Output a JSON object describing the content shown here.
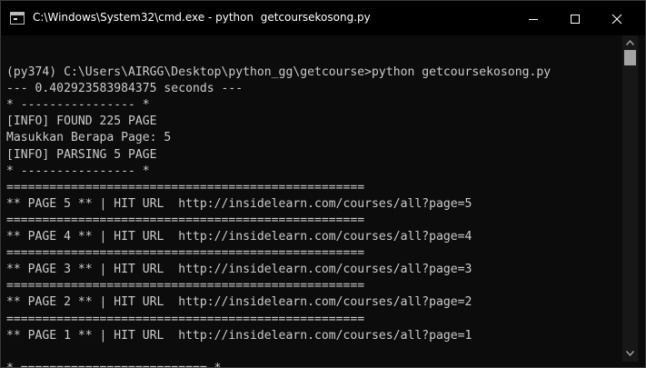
{
  "window": {
    "title": "C:\\Windows\\System32\\cmd.exe - python  getcoursekosong.py"
  },
  "console": {
    "lines": [
      "",
      "(py374) C:\\Users\\AIRGG\\Desktop\\python_gg\\getcourse>python getcoursekosong.py",
      "--- 0.402923583984375 seconds ---",
      "* ---------------- *",
      "[INFO] FOUND 225 PAGE",
      "Masukkan Berapa Page: 5",
      "[INFO] PARSING 5 PAGE",
      "* ---------------- *",
      "==================================================",
      "** PAGE 5 ** | HIT URL  http://insidelearn.com/courses/all?page=5",
      "==================================================",
      "** PAGE 4 ** | HIT URL  http://insidelearn.com/courses/all?page=4",
      "==================================================",
      "** PAGE 3 ** | HIT URL  http://insidelearn.com/courses/all?page=3",
      "==================================================",
      "** PAGE 2 ** | HIT URL  http://insidelearn.com/courses/all?page=2",
      "==================================================",
      "** PAGE 1 ** | HIT URL  http://insidelearn.com/courses/all?page=1",
      "",
      "* ========================== *"
    ]
  },
  "colors": {
    "background": "#0c0c0c",
    "text": "#cccccc",
    "titlebar": "#000000"
  },
  "icons": {
    "app": "cmd-icon",
    "minimize": "minimize-icon",
    "maximize": "maximize-icon",
    "close": "close-icon"
  },
  "scrollbar": {
    "position": 0
  }
}
